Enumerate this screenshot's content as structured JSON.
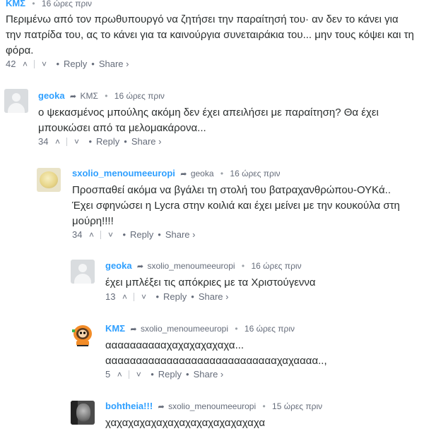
{
  "comments": [
    {
      "author": "ΚΜΣ",
      "reply_to": "",
      "time": "16 ώρες πριν",
      "body_lines": [
        "Περιμένω από τον πρωθυπουργό να ζητήσει την παραίτησή του· αν δεν το κάνει για",
        "την πατρίδα του, ας το κάνει για τα καινούργια συνεταιράκια του... μην τους κόψει και τη",
        "φόρα."
      ],
      "votes": "42",
      "reply_label": "Reply",
      "share_label": "Share ›"
    },
    {
      "author": "geoka",
      "reply_to": "ΚΜΣ",
      "time": "16 ώρες πριν",
      "body_lines": [
        "ο ψεκασμένος μπούλης ακόμη δεν έχει απειλήσει με παραίτηση? Θα έχει",
        "μπουκώσει από τα μελομακάρονα..."
      ],
      "votes": "34",
      "reply_label": "Reply",
      "share_label": "Share ›"
    },
    {
      "author": "sxolio_menoumeeuropi",
      "reply_to": "geoka",
      "time": "16 ώρες πριν",
      "body_lines": [
        "Προσπαθεί ακόμα να βγάλει τη στολή του βατραχανθρώπου-ΟΥΚά..",
        "Έχει σφηνώσει η Lycra στην κοιλιά και έχει μείνει με την κουκούλα στη",
        "μούρη!!!!"
      ],
      "votes": "34",
      "reply_label": "Reply",
      "share_label": "Share ›"
    },
    {
      "author": "geoka",
      "reply_to": "sxolio_menoumeeuropi",
      "time": "16 ώρες πριν",
      "body_lines": [
        "έχει μπλέξει τις απόκριες με τα Χριστούγεννα"
      ],
      "votes": "13",
      "reply_label": "Reply",
      "share_label": "Share ›"
    },
    {
      "author": "ΚΜΣ",
      "reply_to": "sxolio_menoumeeuropi",
      "time": "16 ώρες πριν",
      "body_lines": [
        "ααααααααααχαχαχαχαχαχα...",
        "ααααααααααααααααααααααααααααχαχαααα..,"
      ],
      "votes": "5",
      "reply_label": "Reply",
      "share_label": "Share ›"
    },
    {
      "author": "bohtheia!!!",
      "reply_to": "sxolio_menoumeeuropi",
      "time": "15 ώρες πριν",
      "body_lines": [
        "χαχαχαχαχαχαχαχαχαχαχαχαχαχα"
      ]
    }
  ],
  "icons": {
    "reply_to_arrow": "share-arrow-icon",
    "upvote": "chevron-up-icon",
    "downvote": "chevron-down-icon"
  },
  "colors": {
    "author": "#2e9fff",
    "meta": "#656c7a",
    "text": "#2a2e2e"
  }
}
